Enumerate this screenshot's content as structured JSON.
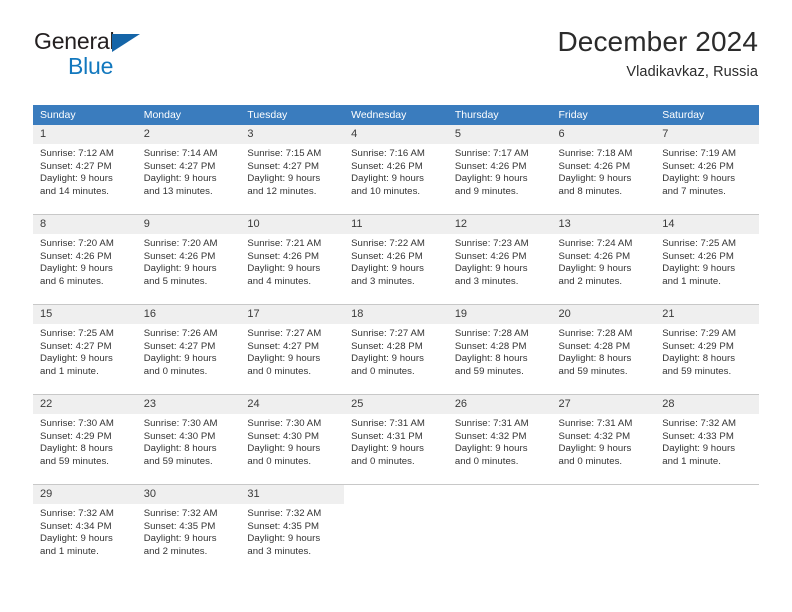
{
  "logo": {
    "word1": "General",
    "word2": "Blue",
    "triangle_color": "#1565a8",
    "blue_color": "#1278be"
  },
  "header": {
    "title": "December 2024",
    "subtitle": "Vladikavkaz, Russia"
  },
  "theme": {
    "header_blue": "#3a7cbe",
    "daynum_gray": "#efefef",
    "grid_line": "#c8c8c8"
  },
  "weekdays": [
    "Sunday",
    "Monday",
    "Tuesday",
    "Wednesday",
    "Thursday",
    "Friday",
    "Saturday"
  ],
  "weeks": [
    [
      {
        "day": "1",
        "sunrise": "Sunrise: 7:12 AM",
        "sunset": "Sunset: 4:27 PM",
        "daylight1": "Daylight: 9 hours",
        "daylight2": "and 14 minutes."
      },
      {
        "day": "2",
        "sunrise": "Sunrise: 7:14 AM",
        "sunset": "Sunset: 4:27 PM",
        "daylight1": "Daylight: 9 hours",
        "daylight2": "and 13 minutes."
      },
      {
        "day": "3",
        "sunrise": "Sunrise: 7:15 AM",
        "sunset": "Sunset: 4:27 PM",
        "daylight1": "Daylight: 9 hours",
        "daylight2": "and 12 minutes."
      },
      {
        "day": "4",
        "sunrise": "Sunrise: 7:16 AM",
        "sunset": "Sunset: 4:26 PM",
        "daylight1": "Daylight: 9 hours",
        "daylight2": "and 10 minutes."
      },
      {
        "day": "5",
        "sunrise": "Sunrise: 7:17 AM",
        "sunset": "Sunset: 4:26 PM",
        "daylight1": "Daylight: 9 hours",
        "daylight2": "and 9 minutes."
      },
      {
        "day": "6",
        "sunrise": "Sunrise: 7:18 AM",
        "sunset": "Sunset: 4:26 PM",
        "daylight1": "Daylight: 9 hours",
        "daylight2": "and 8 minutes."
      },
      {
        "day": "7",
        "sunrise": "Sunrise: 7:19 AM",
        "sunset": "Sunset: 4:26 PM",
        "daylight1": "Daylight: 9 hours",
        "daylight2": "and 7 minutes."
      }
    ],
    [
      {
        "day": "8",
        "sunrise": "Sunrise: 7:20 AM",
        "sunset": "Sunset: 4:26 PM",
        "daylight1": "Daylight: 9 hours",
        "daylight2": "and 6 minutes."
      },
      {
        "day": "9",
        "sunrise": "Sunrise: 7:20 AM",
        "sunset": "Sunset: 4:26 PM",
        "daylight1": "Daylight: 9 hours",
        "daylight2": "and 5 minutes."
      },
      {
        "day": "10",
        "sunrise": "Sunrise: 7:21 AM",
        "sunset": "Sunset: 4:26 PM",
        "daylight1": "Daylight: 9 hours",
        "daylight2": "and 4 minutes."
      },
      {
        "day": "11",
        "sunrise": "Sunrise: 7:22 AM",
        "sunset": "Sunset: 4:26 PM",
        "daylight1": "Daylight: 9 hours",
        "daylight2": "and 3 minutes."
      },
      {
        "day": "12",
        "sunrise": "Sunrise: 7:23 AM",
        "sunset": "Sunset: 4:26 PM",
        "daylight1": "Daylight: 9 hours",
        "daylight2": "and 3 minutes."
      },
      {
        "day": "13",
        "sunrise": "Sunrise: 7:24 AM",
        "sunset": "Sunset: 4:26 PM",
        "daylight1": "Daylight: 9 hours",
        "daylight2": "and 2 minutes."
      },
      {
        "day": "14",
        "sunrise": "Sunrise: 7:25 AM",
        "sunset": "Sunset: 4:26 PM",
        "daylight1": "Daylight: 9 hours",
        "daylight2": "and 1 minute."
      }
    ],
    [
      {
        "day": "15",
        "sunrise": "Sunrise: 7:25 AM",
        "sunset": "Sunset: 4:27 PM",
        "daylight1": "Daylight: 9 hours",
        "daylight2": "and 1 minute."
      },
      {
        "day": "16",
        "sunrise": "Sunrise: 7:26 AM",
        "sunset": "Sunset: 4:27 PM",
        "daylight1": "Daylight: 9 hours",
        "daylight2": "and 0 minutes."
      },
      {
        "day": "17",
        "sunrise": "Sunrise: 7:27 AM",
        "sunset": "Sunset: 4:27 PM",
        "daylight1": "Daylight: 9 hours",
        "daylight2": "and 0 minutes."
      },
      {
        "day": "18",
        "sunrise": "Sunrise: 7:27 AM",
        "sunset": "Sunset: 4:28 PM",
        "daylight1": "Daylight: 9 hours",
        "daylight2": "and 0 minutes."
      },
      {
        "day": "19",
        "sunrise": "Sunrise: 7:28 AM",
        "sunset": "Sunset: 4:28 PM",
        "daylight1": "Daylight: 8 hours",
        "daylight2": "and 59 minutes."
      },
      {
        "day": "20",
        "sunrise": "Sunrise: 7:28 AM",
        "sunset": "Sunset: 4:28 PM",
        "daylight1": "Daylight: 8 hours",
        "daylight2": "and 59 minutes."
      },
      {
        "day": "21",
        "sunrise": "Sunrise: 7:29 AM",
        "sunset": "Sunset: 4:29 PM",
        "daylight1": "Daylight: 8 hours",
        "daylight2": "and 59 minutes."
      }
    ],
    [
      {
        "day": "22",
        "sunrise": "Sunrise: 7:30 AM",
        "sunset": "Sunset: 4:29 PM",
        "daylight1": "Daylight: 8 hours",
        "daylight2": "and 59 minutes."
      },
      {
        "day": "23",
        "sunrise": "Sunrise: 7:30 AM",
        "sunset": "Sunset: 4:30 PM",
        "daylight1": "Daylight: 8 hours",
        "daylight2": "and 59 minutes."
      },
      {
        "day": "24",
        "sunrise": "Sunrise: 7:30 AM",
        "sunset": "Sunset: 4:30 PM",
        "daylight1": "Daylight: 9 hours",
        "daylight2": "and 0 minutes."
      },
      {
        "day": "25",
        "sunrise": "Sunrise: 7:31 AM",
        "sunset": "Sunset: 4:31 PM",
        "daylight1": "Daylight: 9 hours",
        "daylight2": "and 0 minutes."
      },
      {
        "day": "26",
        "sunrise": "Sunrise: 7:31 AM",
        "sunset": "Sunset: 4:32 PM",
        "daylight1": "Daylight: 9 hours",
        "daylight2": "and 0 minutes."
      },
      {
        "day": "27",
        "sunrise": "Sunrise: 7:31 AM",
        "sunset": "Sunset: 4:32 PM",
        "daylight1": "Daylight: 9 hours",
        "daylight2": "and 0 minutes."
      },
      {
        "day": "28",
        "sunrise": "Sunrise: 7:32 AM",
        "sunset": "Sunset: 4:33 PM",
        "daylight1": "Daylight: 9 hours",
        "daylight2": "and 1 minute."
      }
    ],
    [
      {
        "day": "29",
        "sunrise": "Sunrise: 7:32 AM",
        "sunset": "Sunset: 4:34 PM",
        "daylight1": "Daylight: 9 hours",
        "daylight2": "and 1 minute."
      },
      {
        "day": "30",
        "sunrise": "Sunrise: 7:32 AM",
        "sunset": "Sunset: 4:35 PM",
        "daylight1": "Daylight: 9 hours",
        "daylight2": "and 2 minutes."
      },
      {
        "day": "31",
        "sunrise": "Sunrise: 7:32 AM",
        "sunset": "Sunset: 4:35 PM",
        "daylight1": "Daylight: 9 hours",
        "daylight2": "and 3 minutes."
      },
      {
        "day": "",
        "sunrise": "",
        "sunset": "",
        "daylight1": "",
        "daylight2": ""
      },
      {
        "day": "",
        "sunrise": "",
        "sunset": "",
        "daylight1": "",
        "daylight2": ""
      },
      {
        "day": "",
        "sunrise": "",
        "sunset": "",
        "daylight1": "",
        "daylight2": ""
      },
      {
        "day": "",
        "sunrise": "",
        "sunset": "",
        "daylight1": "",
        "daylight2": ""
      }
    ]
  ]
}
